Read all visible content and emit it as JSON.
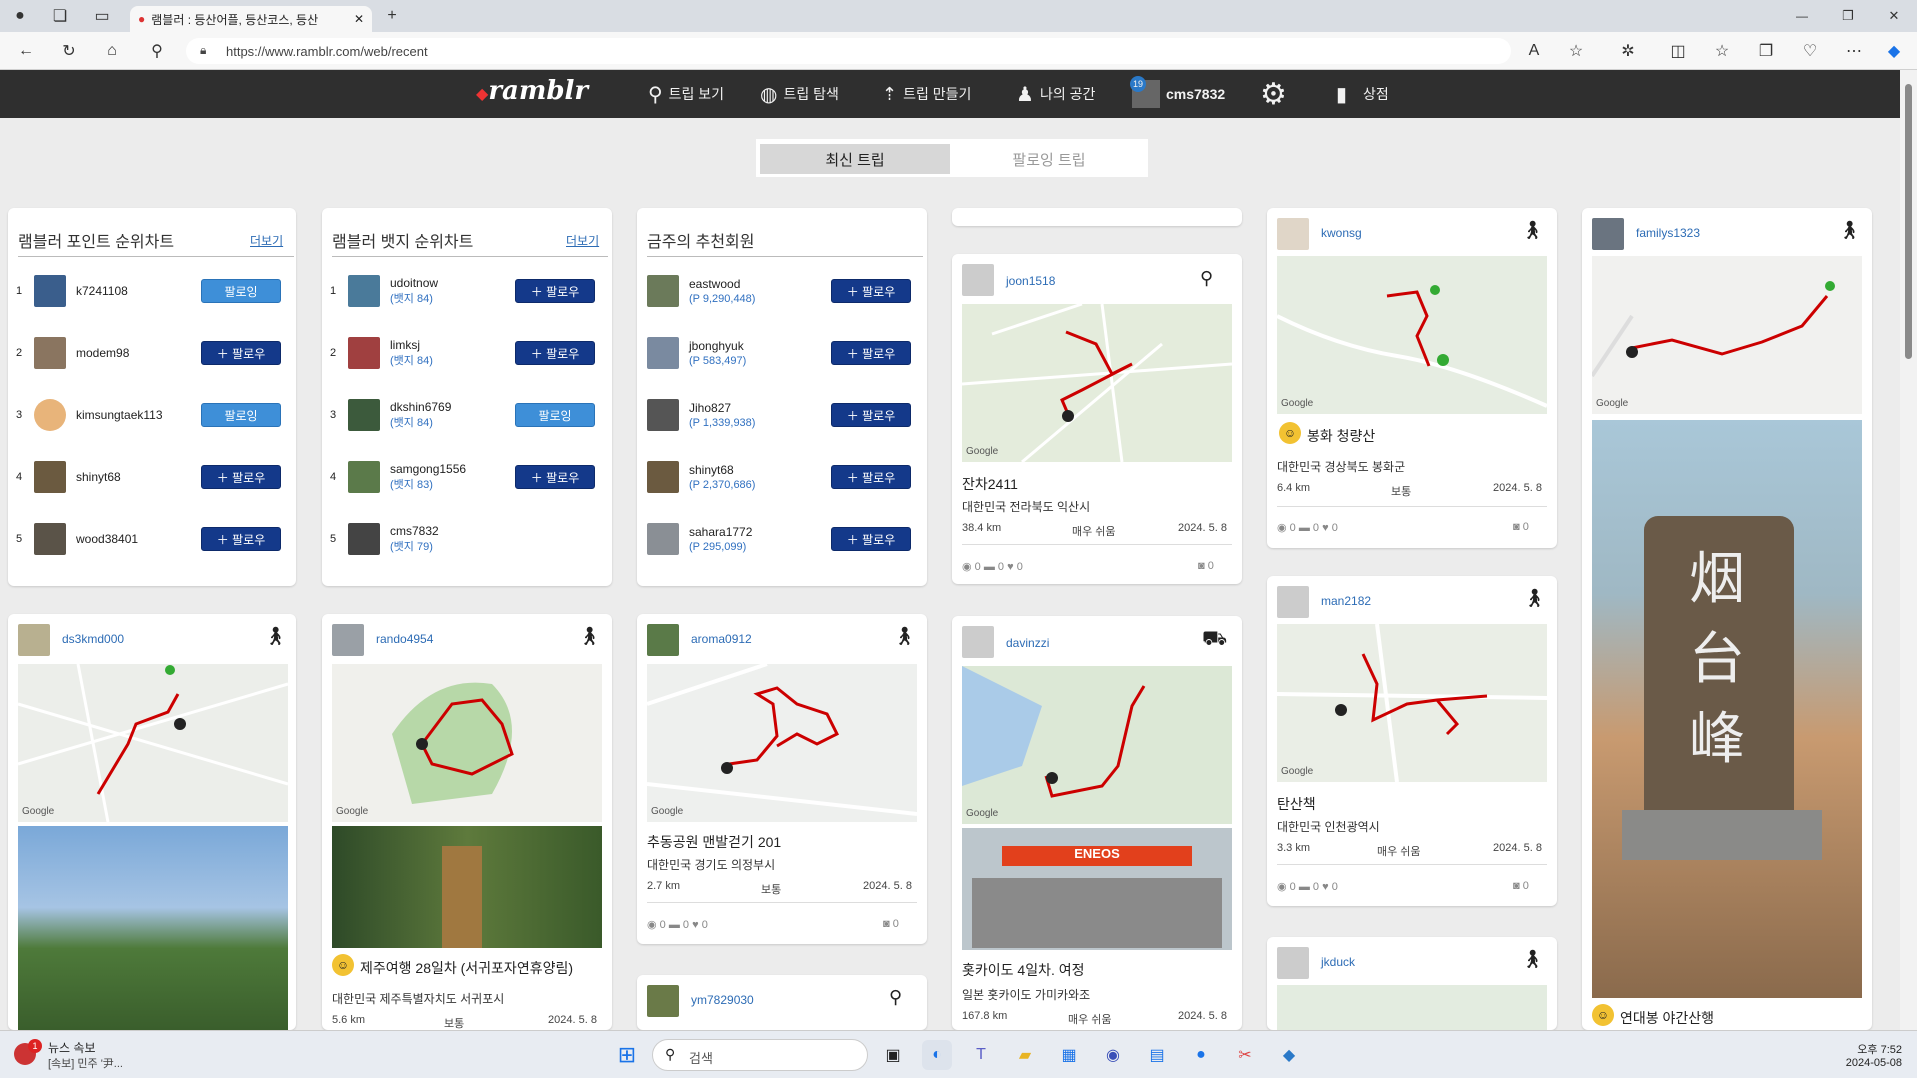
{
  "browser": {
    "tab_title": "램블러 : 등산어플, 등산코스, 등산",
    "new_tab": "+",
    "url": "https://www.ramblr.com/web/recent",
    "window_controls": [
      "—",
      "❐",
      "✕"
    ]
  },
  "site": {
    "logo": "ramblr",
    "nav": [
      {
        "label": "트립 보기",
        "icon": "pin-icon"
      },
      {
        "label": "트립 탐색",
        "icon": "globe-icon"
      },
      {
        "label": "트립 만들기",
        "icon": "create-icon"
      },
      {
        "label": "나의 공간",
        "icon": "person-icon"
      }
    ],
    "user": {
      "name": "cms7832",
      "badge": "19"
    },
    "shop": "상점"
  },
  "toggle": {
    "active": "최신 트립",
    "inactive": "팔로잉 트립"
  },
  "point_chart": {
    "title": "램블러 포인트 순위차트",
    "more": "더보기",
    "rows": [
      {
        "rank": "1",
        "name": "k7241108",
        "btn": "팔로잉",
        "on": true
      },
      {
        "rank": "2",
        "name": "modem98",
        "btn": "팔로우",
        "on": false
      },
      {
        "rank": "3",
        "name": "kimsungtaek113",
        "btn": "팔로잉",
        "on": true
      },
      {
        "rank": "4",
        "name": "shinyt68",
        "btn": "팔로우",
        "on": false
      },
      {
        "rank": "5",
        "name": "wood38401",
        "btn": "팔로우",
        "on": false
      }
    ]
  },
  "badge_chart": {
    "title": "램블러 뱃지 순위차트",
    "more": "더보기",
    "rows": [
      {
        "rank": "1",
        "name": "udoitnow",
        "sub": "(뱃지 84)",
        "btn": "팔로우",
        "on": false
      },
      {
        "rank": "2",
        "name": "limksj",
        "sub": "(뱃지 84)",
        "btn": "팔로우",
        "on": false
      },
      {
        "rank": "3",
        "name": "dkshin6769",
        "sub": "(뱃지 84)",
        "btn": "팔로잉",
        "on": true
      },
      {
        "rank": "4",
        "name": "samgong1556",
        "sub": "(뱃지 83)",
        "btn": "팔로우",
        "on": false
      },
      {
        "rank": "5",
        "name": "cms7832",
        "sub": "(뱃지 79)",
        "btn": "",
        "on": false
      }
    ]
  },
  "recommended": {
    "title": "금주의 추천회원",
    "rows": [
      {
        "name": "eastwood",
        "sub": "(P 9,290,448)",
        "btn": "팔로우"
      },
      {
        "name": "jbonghyuk",
        "sub": "(P 583,497)",
        "btn": "팔로우"
      },
      {
        "name": "Jiho827",
        "sub": "(P 1,339,938)",
        "btn": "팔로우"
      },
      {
        "name": "shinyt68",
        "sub": "(P 2,370,686)",
        "btn": "팔로우"
      },
      {
        "name": "sahara1772",
        "sub": "(P 295,099)",
        "btn": "팔로우"
      }
    ]
  },
  "trips": {
    "joon": {
      "user": "joon1518",
      "title": "잔차2411",
      "loc": "대한민국 전라북도 익산시",
      "dist": "38.4 km",
      "level": "매우 쉬움",
      "date": "2024. 5. 8",
      "views": "0",
      "comments": "0",
      "likes": "0",
      "photos": "0"
    },
    "davinzzi": {
      "user": "davinzzi",
      "title": "홋카이도 4일차. 여정",
      "loc": "일본 홋카이도 가미카와조",
      "dist": "167.8 km",
      "level": "매우 쉬움",
      "date": "2024. 5. 8",
      "sign": "ENEOS"
    },
    "kwonsg": {
      "user": "kwonsg",
      "title": "봉화 청량산",
      "loc": "대한민국 경상북도 봉화군",
      "dist": "6.4 km",
      "level": "보통",
      "date": "2024. 5. 8",
      "views": "0",
      "comments": "0",
      "likes": "0",
      "photos": "0"
    },
    "man": {
      "user": "man2182",
      "title": "탄산책",
      "loc": "대한민국 인천광역시",
      "dist": "3.3 km",
      "level": "매우 쉬움",
      "date": "2024. 5. 8",
      "views": "0",
      "comments": "0",
      "likes": "0",
      "photos": "0"
    },
    "jkduck": {
      "user": "jkduck"
    },
    "families": {
      "user": "familys1323",
      "title": "연대봉 야간산행",
      "stone": "烟台峰"
    },
    "ds3": {
      "user": "ds3kmd000"
    },
    "rando": {
      "user": "rando4954",
      "title": "제주여행 28일차 (서귀포자연휴양림)",
      "loc": "대한민국 제주특별자치도 서귀포시",
      "dist": "5.6 km",
      "level": "보통",
      "date": "2024. 5. 8"
    },
    "aroma": {
      "user": "aroma0912",
      "title": "추동공원 맨발걷기 201",
      "loc": "대한민국 경기도 의정부시",
      "dist": "2.7 km",
      "level": "보통",
      "date": "2024. 5. 8",
      "views": "0",
      "comments": "0",
      "likes": "0",
      "photos": "0"
    },
    "ym": {
      "user": "ym7829030"
    }
  },
  "google": "Google",
  "taskbar": {
    "news_title": "뉴스 속보",
    "news_sub": "[속보] 민주 '尹...",
    "news_badge": "1",
    "search": "검색",
    "time": "오후 7:52",
    "date": "2024-05-08"
  }
}
